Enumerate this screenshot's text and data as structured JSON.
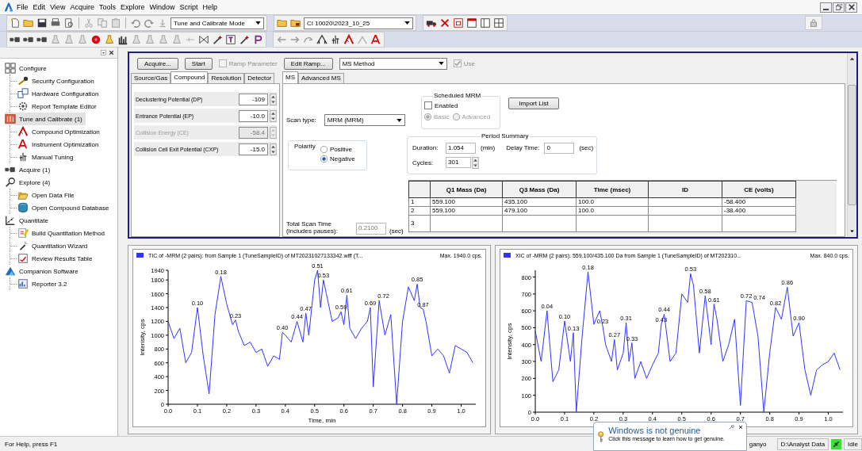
{
  "window": {
    "menu": [
      "File",
      "Edit",
      "View",
      "Acquire",
      "Tools",
      "Explore",
      "Window",
      "Script",
      "Help"
    ]
  },
  "toolbar": {
    "mode_dropdown": "Tune and Calibrate Mode",
    "project_dropdown": "CI 10020\\2023_10_25"
  },
  "navigation": {
    "groups": [
      {
        "label": "Configure",
        "selected": false,
        "children": [
          {
            "label": "Security Configuration",
            "selected": false
          },
          {
            "label": "Hardware Configuration",
            "selected": false
          },
          {
            "label": "Report Template Editor",
            "selected": false
          }
        ]
      },
      {
        "label": "Tune and Calibrate (1)",
        "selected": true,
        "children": [
          {
            "label": "Compound Optimization",
            "selected": false
          },
          {
            "label": "Instrument Optimization",
            "selected": false
          },
          {
            "label": "Manual Tuning",
            "selected": false
          }
        ]
      },
      {
        "label": "Acquire (1)",
        "selected": false
      },
      {
        "label": "Explore (4)",
        "selected": false,
        "children": [
          {
            "label": "Open Data File",
            "selected": false
          },
          {
            "label": "Open Compound Database",
            "selected": false
          }
        ]
      },
      {
        "label": "Quantitate",
        "selected": false,
        "children": [
          {
            "label": "Build Quantitation Method",
            "selected": false
          },
          {
            "label": "Quantitation Wizard",
            "selected": false
          },
          {
            "label": "Review Results Table",
            "selected": false
          }
        ]
      },
      {
        "label": "Companion Software",
        "selected": false,
        "children": [
          {
            "label": "Reporter 3.2",
            "selected": false
          }
        ]
      }
    ]
  },
  "method_panel": {
    "acquire_button": "Acquire...",
    "start_button": "Start",
    "ramp_parameter": {
      "label": "Ramp Parameter",
      "checked": false,
      "disabled": true
    },
    "edit_ramp_button": "Edit Ramp...",
    "method_dropdown": "MS Method",
    "use": {
      "label": "Use",
      "checked": true,
      "disabled": true
    },
    "parameter_tabs": [
      {
        "label": "Source/Gas",
        "selected": false
      },
      {
        "label": "Compound",
        "selected": true
      },
      {
        "label": "Resolution",
        "selected": false
      },
      {
        "label": "Detector",
        "selected": false
      }
    ],
    "parameters": [
      {
        "label": "Declustering Potential (DP)",
        "value": "-109",
        "disabled": false
      },
      {
        "label": "Entrance Potential (EP)",
        "value": "-10.0",
        "disabled": false
      },
      {
        "label": "Collision Energy (CE)",
        "value": "-58.4",
        "disabled": true
      },
      {
        "label": "Collision Cell Exit Potential (CXP)",
        "value": "-15.0",
        "disabled": false
      }
    ],
    "ms_tabs": [
      {
        "label": "MS",
        "selected": true
      },
      {
        "label": "Advanced MS",
        "selected": false
      }
    ],
    "scheduled_mrm": {
      "title": "Scheduled MRM",
      "enabled": {
        "label": "Enabled",
        "checked": false
      },
      "modes": [
        {
          "label": "Basic",
          "selected": true,
          "disabled": true
        },
        {
          "label": "Advanced",
          "selected": false,
          "disabled": true
        }
      ]
    },
    "import_list_button": "Import List",
    "scan_type": {
      "label": "Scan type:",
      "value": "MRM (MRM)"
    },
    "polarity": {
      "title": "Polarity",
      "options": [
        {
          "label": "Positive",
          "selected": false
        },
        {
          "label": "Negative",
          "selected": true
        }
      ]
    },
    "period_summary": {
      "title": "Period Summary",
      "duration": {
        "label": "Duration:",
        "value": "1.054",
        "unit": "(min)"
      },
      "delay_time": {
        "label": "Delay Time:",
        "value": "0",
        "unit": "(sec)"
      },
      "cycles": {
        "label": "Cycles:",
        "value": "301"
      }
    },
    "transitions_table": {
      "columns": [
        "Q1 Mass (Da)",
        "Q3 Mass (Da)",
        "Time (msec)",
        "ID",
        "CE (volts)"
      ],
      "rows": [
        {
          "number": "1",
          "q1_mass": "559.100",
          "q3_mass": "435.100",
          "time": "100.0",
          "ce": "-58.400",
          "selected": false
        },
        {
          "number": "2",
          "q1_mass": "559.100",
          "q3_mass": "479.100",
          "time": "100.0",
          "ce": "-38.400",
          "selected": false
        },
        {
          "number": "3",
          "selected": false
        }
      ]
    },
    "total_scan_time": {
      "label": "Total Scan Time (includes pauses):",
      "value": "0.2100",
      "unit": "(sec)"
    }
  },
  "charts": [
    {
      "max_label": "Max. 1940.0 cps.",
      "chart_data": {
        "type": "line",
        "title": "TIC of -MRM (2 pairs): from Sample 1 (TuneSampleID) of MT20231027133342.wiff (T...",
        "xlabel": "Time, min",
        "ylabel": "Intensity, cps",
        "x": [
          0,
          0.02,
          0.04,
          0.06,
          0.08,
          0.1,
          0.12,
          0.14,
          0.16,
          0.18,
          0.2,
          0.22,
          0.23,
          0.24,
          0.26,
          0.28,
          0.3,
          0.32,
          0.34,
          0.36,
          0.38,
          0.39,
          0.4,
          0.42,
          0.44,
          0.46,
          0.47,
          0.48,
          0.5,
          0.51,
          0.52,
          0.53,
          0.54,
          0.56,
          0.58,
          0.59,
          0.6,
          0.61,
          0.62,
          0.64,
          0.66,
          0.68,
          0.69,
          0.7,
          0.72,
          0.74,
          0.76,
          0.78,
          0.8,
          0.82,
          0.84,
          0.85,
          0.86,
          0.87,
          0.88,
          0.9,
          0.92,
          0.94,
          0.96,
          0.98,
          1.0,
          1.02,
          1.04
        ],
        "series": [
          {
            "color": "#3333ff",
            "values": [
              1200,
              950,
              1100,
              600,
              750,
              1400,
              700,
              150,
              1300,
              1850,
              1450,
              1150,
              1220,
              1050,
              850,
              900,
              750,
              800,
              550,
              700,
              650,
              1040,
              1000,
              900,
              1200,
              900,
              1320,
              1000,
              1800,
              1940,
              1400,
              1800,
              1600,
              1200,
              1250,
              1340,
              1150,
              1580,
              1100,
              950,
              1100,
              1200,
              1400,
              250,
              1500,
              1000,
              1300,
              0,
              1200,
              1700,
              1500,
              1740,
              1400,
              1380,
              1200,
              700,
              800,
              700,
              450,
              850,
              800,
              750,
              600
            ]
          }
        ],
        "xlim": [
          0,
          1.05
        ],
        "ylim": [
          0,
          1940
        ],
        "xticks": [
          {
            "value": 0,
            "label": "0.0"
          },
          {
            "value": 0.1,
            "label": "0.1"
          },
          {
            "value": 0.2,
            "label": "0.2"
          },
          {
            "value": 0.3,
            "label": "0.3"
          },
          {
            "value": 0.4,
            "label": "0.4"
          },
          {
            "value": 0.5,
            "label": "0.5"
          },
          {
            "value": 0.6,
            "label": "0.6"
          },
          {
            "value": 0.7,
            "label": "0.7"
          },
          {
            "value": 0.8,
            "label": "0.8"
          },
          {
            "value": 0.9,
            "label": "0.9"
          },
          {
            "value": 1.0,
            "label": "1.0"
          }
        ],
        "yticks": [
          0,
          200,
          400,
          600,
          800,
          1000,
          1200,
          1400,
          1600,
          1800,
          1940
        ],
        "annotations": [
          {
            "x": 0.1,
            "y": 1400,
            "text": "0.10"
          },
          {
            "x": 0.18,
            "y": 1850,
            "text": "0.18"
          },
          {
            "x": 0.23,
            "y": 1220,
            "text": "0.23"
          },
          {
            "x": 0.39,
            "y": 1040,
            "text": "0.40"
          },
          {
            "x": 0.44,
            "y": 1200,
            "text": "0.44"
          },
          {
            "x": 0.47,
            "y": 1320,
            "text": "0.47"
          },
          {
            "x": 0.51,
            "y": 1940,
            "text": "0.51"
          },
          {
            "x": 0.53,
            "y": 1800,
            "text": "0.53"
          },
          {
            "x": 0.59,
            "y": 1340,
            "text": "0.59"
          },
          {
            "x": 0.61,
            "y": 1580,
            "text": "0.61"
          },
          {
            "x": 0.69,
            "y": 1400,
            "text": "0.69"
          },
          {
            "x": 0.72,
            "y": 1500,
            "text": "0.72"
          },
          {
            "x": 0.85,
            "y": 1740,
            "text": "0.85"
          },
          {
            "x": 0.87,
            "y": 1380,
            "text": "0.87"
          }
        ]
      }
    },
    {
      "max_label": "Max. 840.0 cps.",
      "chart_data": {
        "type": "line",
        "title": "XIC of -MRM (2 pairs): 559.100/435.100 Da  from Sample 1 (TuneSampleID) of MT202310...",
        "ylabel": "Intensity, cps",
        "x": [
          0,
          0.02,
          0.04,
          0.06,
          0.08,
          0.1,
          0.12,
          0.13,
          0.14,
          0.16,
          0.18,
          0.2,
          0.22,
          0.23,
          0.24,
          0.26,
          0.27,
          0.28,
          0.3,
          0.31,
          0.32,
          0.33,
          0.34,
          0.36,
          0.38,
          0.4,
          0.42,
          0.43,
          0.44,
          0.46,
          0.48,
          0.5,
          0.52,
          0.53,
          0.54,
          0.56,
          0.58,
          0.6,
          0.61,
          0.62,
          0.64,
          0.66,
          0.68,
          0.7,
          0.72,
          0.74,
          0.76,
          0.78,
          0.8,
          0.82,
          0.84,
          0.86,
          0.88,
          0.9,
          0.92,
          0.94,
          0.96,
          0.98,
          1.0,
          1.02,
          1.04
        ],
        "series": [
          {
            "color": "#3333ff",
            "values": [
              480,
              300,
              600,
              180,
              250,
              540,
              300,
              470,
              0,
              450,
              830,
              520,
              600,
              510,
              400,
              300,
              430,
              250,
              350,
              530,
              300,
              410,
              200,
              300,
              200,
              280,
              350,
              520,
              580,
              300,
              350,
              700,
              650,
              820,
              750,
              350,
              690,
              400,
              640,
              550,
              300,
              400,
              550,
              40,
              660,
              650,
              450,
              0,
              350,
              620,
              550,
              740,
              450,
              530,
              250,
              100,
              250,
              280,
              300,
              350,
              250
            ]
          }
        ],
        "xlim": [
          0,
          1.05
        ],
        "ylim": [
          0,
          840
        ],
        "xticks": [
          {
            "value": 0,
            "label": "0.0"
          },
          {
            "value": 0.1,
            "label": "0.1"
          },
          {
            "value": 0.2,
            "label": "0.2"
          },
          {
            "value": 0.3,
            "label": "0.3"
          },
          {
            "value": 0.4,
            "label": "0.4"
          },
          {
            "value": 0.5,
            "label": "0.5"
          },
          {
            "value": 0.6,
            "label": "0.6"
          },
          {
            "value": 0.7,
            "label": "0.7"
          },
          {
            "value": 0.8,
            "label": "0.8"
          },
          {
            "value": 0.9,
            "label": "0.9"
          },
          {
            "value": 1.0,
            "label": "1.0"
          }
        ],
        "yticks": [
          0,
          100,
          200,
          300,
          400,
          500,
          600,
          700,
          800
        ],
        "annotations": [
          {
            "x": 0.04,
            "y": 600,
            "text": "0.04"
          },
          {
            "x": 0.1,
            "y": 540,
            "text": "0.10"
          },
          {
            "x": 0.13,
            "y": 470,
            "text": "0.13"
          },
          {
            "x": 0.18,
            "y": 830,
            "text": "0.18"
          },
          {
            "x": 0.23,
            "y": 510,
            "text": "0.23"
          },
          {
            "x": 0.27,
            "y": 430,
            "text": "0.27"
          },
          {
            "x": 0.31,
            "y": 530,
            "text": "0.31"
          },
          {
            "x": 0.33,
            "y": 410,
            "text": "0.33"
          },
          {
            "x": 0.43,
            "y": 520,
            "text": "0.43"
          },
          {
            "x": 0.44,
            "y": 580,
            "text": "0.44"
          },
          {
            "x": 0.53,
            "y": 820,
            "text": "0.53"
          },
          {
            "x": 0.58,
            "y": 690,
            "text": "0.58"
          },
          {
            "x": 0.61,
            "y": 640,
            "text": "0.61"
          },
          {
            "x": 0.72,
            "y": 660,
            "text": "0.72"
          },
          {
            "x": 0.74,
            "y": 650,
            "text": "0.74"
          },
          {
            "x": 0.82,
            "y": 620,
            "text": "0.82"
          },
          {
            "x": 0.86,
            "y": 740,
            "text": "0.86"
          },
          {
            "x": 0.9,
            "y": 530,
            "text": "0.90"
          }
        ]
      }
    }
  ],
  "status_bar": {
    "help": "For Help, press F1",
    "user": "ganyo",
    "data_path": "D:\\Analyst Data",
    "state": "Idle"
  },
  "notification": {
    "title": "Windows is not genuine",
    "message": "Click this message to learn how to get genuine."
  }
}
